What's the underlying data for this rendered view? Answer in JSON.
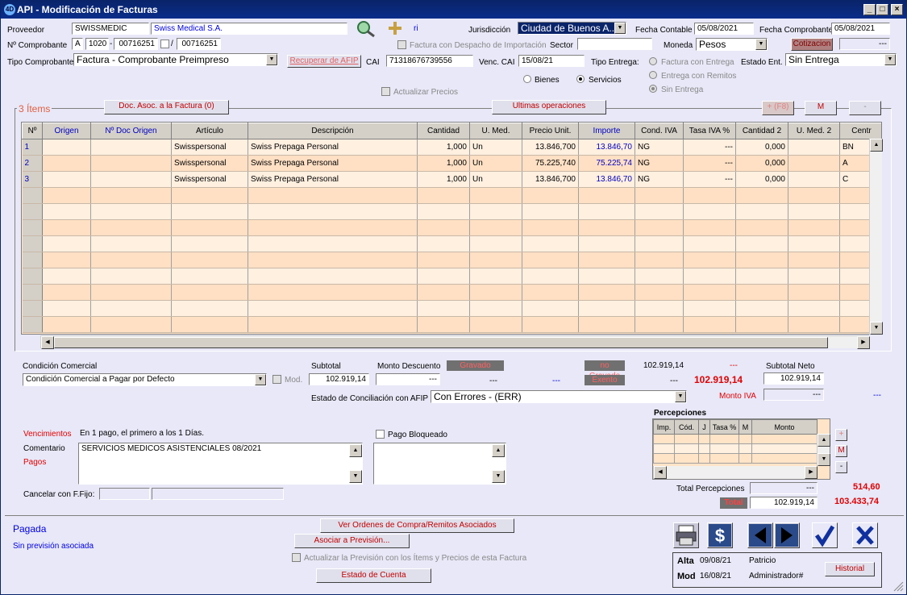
{
  "window": {
    "title": "API - Modificación de Facturas"
  },
  "header": {
    "proveedor_label": "Proveedor",
    "proveedor_code": "SWISSMEDIC",
    "proveedor_name": "Swiss Medical S.A.",
    "ri": "ri",
    "jurisdiccion_label": "Jurisdicción",
    "jurisdiccion_value": "Ciudad de Buenos A...",
    "fecha_contable_label": "Fecha Contable",
    "fecha_contable": "05/08/2021",
    "fecha_comprobante_label": "Fecha Comprobante",
    "fecha_comprobante": "05/08/2021",
    "nro_comprobante_label": "Nº Comprobante",
    "letra": "A",
    "punto_venta": "1020",
    "numero": "00716251",
    "numero_hasta": "00716251",
    "dash": "-",
    "slash": "/",
    "despacho_label": "Factura con Despacho de Importación",
    "sector_label": "Sector",
    "moneda_label": "Moneda",
    "moneda_value": "Pesos",
    "cotizacion_label": "Cotizacion",
    "cotizacion_value": "---",
    "tipo_label": "Tipo Comprobante",
    "tipo_value": "Factura - Comprobante Preimpreso",
    "recuperar_afip": "Recuperar de AFIP",
    "cai_label": "CAI",
    "cai_value": "71318676739556",
    "venc_cai_label": "Venc. CAI",
    "venc_cai_value": "15/08/21",
    "tipo_entrega_label": "Tipo Entrega:",
    "entrega_op1": "Factura con Entrega",
    "entrega_op2": "Entrega con Remitos",
    "entrega_op3": "Sin Entrega",
    "estado_ent_label": "Estado Ent.",
    "estado_ent_value": "Sin Entrega",
    "bienes_label": "Bienes",
    "servicios_label": "Servicios",
    "actualizar_precios": "Actualizar Precios"
  },
  "items": {
    "title": "3 Ítems",
    "doc_asoc": "Doc. Asoc. a la Factura (0)",
    "ultimas": "Ultimas operaciones",
    "add": "+ (F8)",
    "mod": "M",
    "del": "-",
    "columns": [
      "Nº",
      "Origen",
      "Nº Doc Origen",
      "Artículo",
      "Descripción",
      "Cantidad",
      "U. Med.",
      "Precio Unit.",
      "Importe",
      "Cond. IVA",
      "Tasa IVA %",
      "Cantidad 2",
      "U. Med. 2",
      "Centr"
    ],
    "rows": [
      [
        "1",
        "",
        "",
        "Swisspersonal",
        "Swiss Prepaga Personal",
        "1,000",
        "Un",
        "13.846,700",
        "13.846,70",
        "NG",
        "---",
        "0,000",
        "",
        "BN"
      ],
      [
        "2",
        "",
        "",
        "Swisspersonal",
        "Swiss Prepaga Personal",
        "1,000",
        "Un",
        "75.225,740",
        "75.225,74",
        "NG",
        "---",
        "0,000",
        "",
        "A"
      ],
      [
        "3",
        "",
        "",
        "Swisspersonal",
        "Swiss Prepaga Personal",
        "1,000",
        "Un",
        "13.846,700",
        "13.846,70",
        "NG",
        "---",
        "0,000",
        "",
        "C"
      ]
    ]
  },
  "totals": {
    "condicion_label": "Condición Comercial",
    "condicion_value": "Condición Comercial a Pagar por Defecto",
    "mod_label": "Mod.",
    "subtotal_label": "Subtotal",
    "subtotal": "102.919,14",
    "monto_desc_label": "Monto Descuento",
    "monto_desc": "---",
    "gravado_label": "Gravado",
    "gravado_a": "---",
    "gravado_b": "---",
    "no_gravado_label": "no Gravado",
    "no_gravado": "102.919,14",
    "no_gravado_dash": "---",
    "exento_label": "Exento",
    "exento": "---",
    "total_red": "102.919,14",
    "subtotal_neto_label": "Subtotal Neto",
    "subtotal_neto": "102.919,14",
    "monto_iva_label": "Monto IVA",
    "monto_iva": "---",
    "monto_iva_b": "---",
    "conciliacion_label": "Estado de Conciliación con AFIP",
    "conciliacion_value": "Con Errores - (ERR)"
  },
  "vencimientos": {
    "label": "Vencimientos",
    "value": "En 1 pago, el primero a los 1 Días.",
    "comentario_label": "Comentario",
    "pagos_label": "Pagos",
    "comentario": "SERVICIOS MEDICOS ASISTENCIALES 08/2021",
    "pago_bloqueado": "Pago Bloqueado",
    "cancelar_label": "Cancelar con F.Fijo:"
  },
  "percepciones": {
    "title": "Percepciones",
    "columns": [
      "Imp.",
      "Cód.",
      "J",
      "Tasa %",
      "M",
      "Monto"
    ],
    "total_label": "Total Percepciones",
    "total_value": "---",
    "total_red": "514,60",
    "plus": "+",
    "m": "M",
    "minus": "-"
  },
  "total": {
    "label": "Total",
    "value": "102.919,14",
    "red": "103.433,74"
  },
  "footer": {
    "estado": "Pagada",
    "prevision": "Sin previsión asociada",
    "ver_ordenes": "Ver Ordenes de Compra/Remitos Asociados",
    "asociar": "Asociar a Previsión...",
    "actualizar_prev": "Actualizar la Previsión con los Ítems y Precios de esta Factura",
    "estado_cuenta": "Estado de Cuenta",
    "alta_label": "Alta",
    "alta_fecha": "09/08/21",
    "alta_user": "Patricio",
    "mod_label": "Mod",
    "mod_fecha": "16/08/21",
    "mod_user": "Administrador#",
    "historial": "Historial"
  }
}
